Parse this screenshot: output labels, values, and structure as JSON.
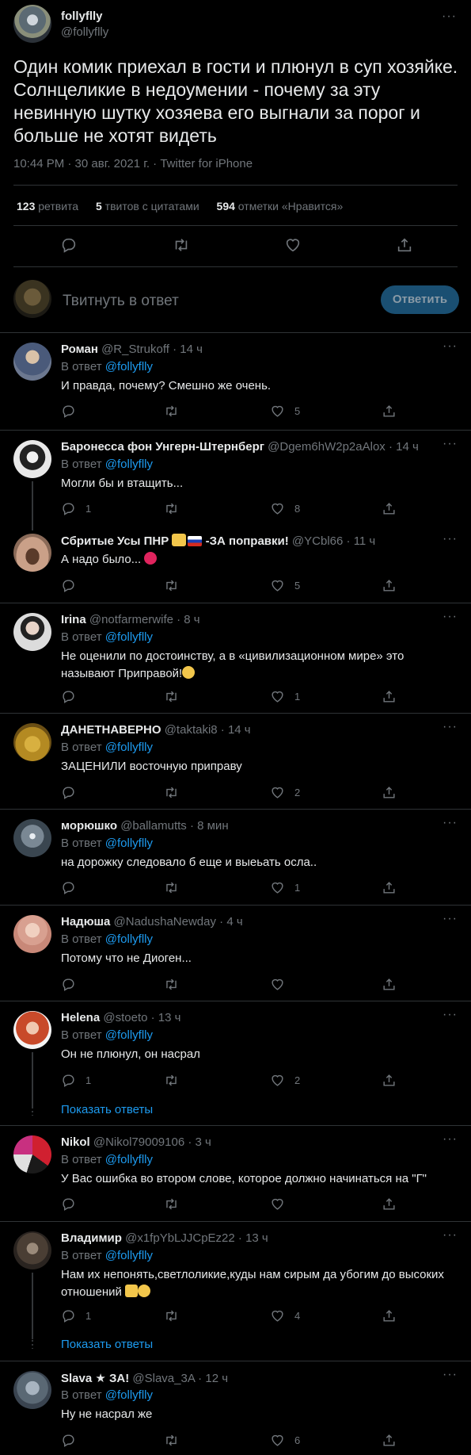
{
  "main_tweet": {
    "name": "follyflly",
    "handle": "@follyflly",
    "text": "Один комик приехал в гости и плюнул в суп хозяйке. Солнцеликие в недоумении - почему за эту невинную шутку хозяева его выгнали за порог и больше не хотят видеть",
    "meta": "10:44 PM · 30 авг. 2021 г. · Twitter for iPhone",
    "stats": {
      "retweets_count": "123",
      "retweets_label": "ретвита",
      "quotes_count": "5",
      "quotes_label": "твитов с цитатами",
      "likes_count": "594",
      "likes_label": "отметки «Нравится»"
    }
  },
  "composer": {
    "placeholder": "Твитнуть в ответ",
    "button": "Ответить"
  },
  "replies": [
    {
      "name": "Роман",
      "handle": "@R_Strukoff",
      "time": " · 14 ч",
      "reply_to_label": "В ответ",
      "reply_to": "@follyflly",
      "text": "И правда, почему? Смешно же очень.",
      "replies": "",
      "likes": "5"
    },
    {
      "name": "Баронесса фон Унгерн-Штернберг",
      "handle": "@Dgem6hW2p2aAlox",
      "time": " · 14 ч",
      "reply_to_label": "В ответ",
      "reply_to": "@follyflly",
      "text": "Могли бы и втащить...",
      "replies": "1",
      "likes": "8"
    },
    {
      "name": "Сбритые Усы ПНР",
      "handle": "@YCbl66",
      "time": " · 11 ч",
      "name_suffix": " -ЗА поправки!",
      "reply_to_label": "",
      "reply_to": "",
      "text": "А надо было...",
      "replies": "",
      "likes": "5"
    },
    {
      "name": "Irina",
      "handle": "@notfarmerwife",
      "time": " · 8 ч",
      "reply_to_label": "В ответ",
      "reply_to": "@follyflly",
      "text": "Не оценили по достоинству, а в «цивилизационном мире» это называют Приправой!",
      "replies": "",
      "likes": "1"
    },
    {
      "name": "ДАНЕТНАВЕРНО",
      "handle": "@taktaki8",
      "time": " · 14 ч",
      "reply_to_label": "В ответ",
      "reply_to": "@follyflly",
      "text": "ЗАЦЕНИЛИ восточную приправу",
      "replies": "",
      "likes": "2"
    },
    {
      "name": "морюшко",
      "handle": "@ballamutts",
      "time": " · 8 мин",
      "reply_to_label": "В ответ",
      "reply_to": "@follyflly",
      "text": "на дорожку следовало б еще и выеьать осла..",
      "replies": "",
      "likes": "1"
    },
    {
      "name": "Надюша",
      "handle": "@NadushaNewday",
      "time": " · 4 ч",
      "reply_to_label": "В ответ",
      "reply_to": "@follyflly",
      "text": "Потому что не Диоген...",
      "replies": "",
      "likes": ""
    },
    {
      "name": "Helena",
      "handle": "@stoeto",
      "time": " · 13 ч",
      "reply_to_label": "В ответ",
      "reply_to": "@follyflly",
      "text": "Он не плюнул, он насрал",
      "replies": "1",
      "likes": "2",
      "show_replies": "Показать ответы"
    },
    {
      "name": "Nikol",
      "handle": "@Nikol79009106",
      "time": " · 3 ч",
      "reply_to_label": "В ответ",
      "reply_to": "@follyflly",
      "text": "У Вас ошибка во втором слове, которое должно начинаться на \"Г\"",
      "replies": "",
      "likes": ""
    },
    {
      "name": "Владимир",
      "handle": "@x1fpYbLJJCpEz22",
      "time": " · 13 ч",
      "reply_to_label": "В ответ",
      "reply_to": "@follyflly",
      "text": "Нам их непонять,светлоликие,куды нам сирым да убогим до высоких отношений",
      "replies": "1",
      "likes": "4",
      "show_replies": "Показать ответы"
    },
    {
      "name": "Slava ★ ЗА!",
      "handle": "@Slava_3A",
      "time": " · 12 ч",
      "reply_to_label": "В ответ",
      "reply_to": "@follyflly",
      "text": "Ну не насрал же",
      "replies": "",
      "likes": "6"
    }
  ],
  "colors": {
    "accent": "#1d9bf0",
    "background": "#000000",
    "text": "#e7e9ea",
    "muted": "#71767b",
    "border": "#2f3336"
  },
  "icons": [
    "reply-icon",
    "retweet-icon",
    "like-icon",
    "share-icon",
    "more-icon"
  ]
}
